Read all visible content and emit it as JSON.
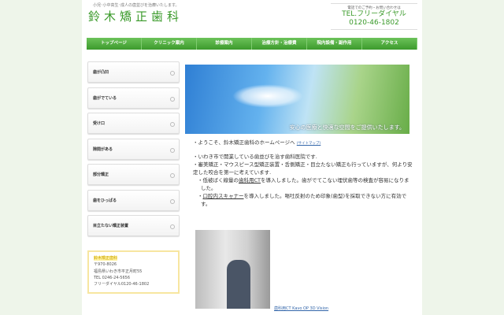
{
  "header": {
    "tagline": "小児･小中高生･成人の歯並びを治療いたします。",
    "logo": "鈴木矯正歯科",
    "tel_note": "電話でのご予約・お問い合わせは",
    "tel_label": "TEL.フリーダイヤル",
    "tel_number": "0120-46-1802"
  },
  "nav": [
    "トップページ",
    "クリニック案内",
    "診療案内",
    "治療方針・治療費",
    "院内設備・副作用",
    "アクセス"
  ],
  "sidebar": [
    "歯が凸凹",
    "歯がでている",
    "受け口",
    "隙間がある",
    "部分矯正",
    "歯をひっぱる",
    "目立たない矯正装置"
  ],
  "address": {
    "name": "鈴木矯正歯科",
    "zip": "〒970-8026",
    "addr": "福島県いわき市平正月町55",
    "tel": "TEL 0246-24-5656",
    "free": "フリーダイヤル0120-46-1802"
  },
  "hero": {
    "caption": "安心の医療と快適な空間をご提供いたします。"
  },
  "main": {
    "welcome": "・ようこそ、鈴木矯正歯科のホームページへ",
    "sitemap": "(サイトマップ)",
    "l1": "・いわき市で開業している歯並びを治す歯科医院です.",
    "l2": "・審美矯正・マウスピース型矯正装置・舌側矯正・目立たない矯正も行っていますが、何より安定した咬合を第一に考えています.",
    "l3a": "・低被ばく線量の",
    "l3link": "歯科用CT",
    "l3b": "を導入しました。歯がでてこない埋伏歯等の検査が容易になりました。",
    "l4link": "口腔内スキャナー",
    "l4b": "を導入しました。嘔吐反射のため印象(歯型)を採取できない方に有効です。"
  },
  "photo": {
    "caption": "歯科用CT Kavo OP 3D Vision"
  }
}
